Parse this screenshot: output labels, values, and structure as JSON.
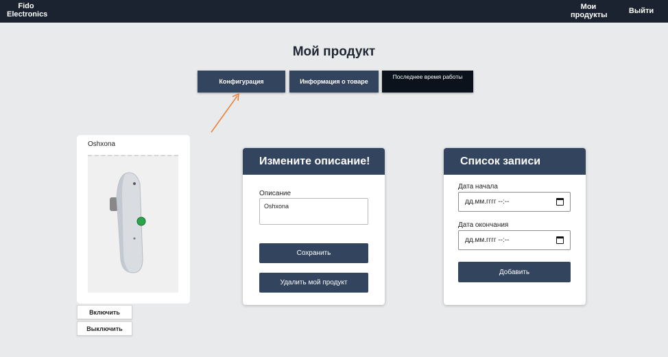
{
  "navbar": {
    "brand": "Fido Electronics",
    "my_products": "Мои продукты",
    "logout": "Выйти"
  },
  "page": {
    "title": "Мой продукт"
  },
  "tabs": [
    {
      "label": "Конфигурация"
    },
    {
      "label": "Информация о товаре"
    },
    {
      "label": "Последнее время работы"
    }
  ],
  "product": {
    "name": "Oshxona",
    "turn_on": "Включить",
    "turn_off": "Выключить"
  },
  "description_panel": {
    "title": "Измените описание!",
    "field_label": "Описание",
    "field_value": "Oshxona",
    "save_label": "Сохранить",
    "delete_label": "Удалить мой продукт"
  },
  "records_panel": {
    "title": "Список записи",
    "start_label": "Дата начала",
    "start_value": "дд.мм.гггг --:--",
    "end_label": "Дата окончания",
    "end_value": "дд.мм.гггг --:--",
    "add_label": "Добавить"
  },
  "colors": {
    "navbar": "#1c2330",
    "accent": "#33445e",
    "annotation_arrow": "#e8833a"
  }
}
